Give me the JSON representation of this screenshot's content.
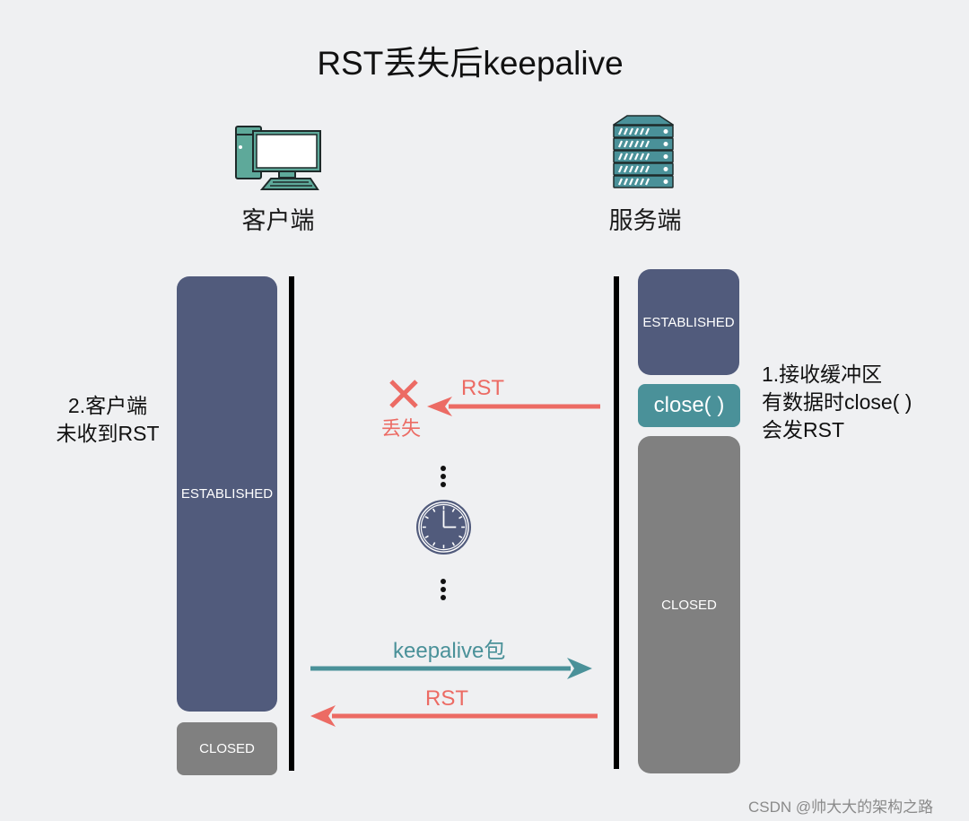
{
  "title": "RST丢失后keepalive",
  "nodes": {
    "client": {
      "label": "客户端",
      "icon": "computer-icon"
    },
    "server": {
      "label": "服务端",
      "icon": "server-rack-icon"
    }
  },
  "client_states": {
    "established": "ESTABLISHED",
    "closed": "CLOSED"
  },
  "server_states": {
    "established": "ESTABLISHED",
    "close_call": "close( )",
    "closed": "CLOSED"
  },
  "notes": {
    "server_note": [
      "1.接收缓冲区",
      "有数据时close( )",
      "会发RST"
    ],
    "client_note": [
      "2.客户端",
      "未收到RST"
    ]
  },
  "messages": {
    "rst_lost": {
      "label": "RST",
      "lost_label": "丢失",
      "direction": "server-to-client",
      "status": "lost"
    },
    "wait": {
      "icon": "clock-icon"
    },
    "keepalive": {
      "label": "keepalive包",
      "direction": "client-to-server"
    },
    "rst_reply": {
      "label": "RST",
      "direction": "server-to-client"
    }
  },
  "colors": {
    "background": "#eff0f2",
    "established": "#515b7c",
    "closed": "#808080",
    "close_call": "#4a9199",
    "rst": "#ec6b64",
    "keepalive": "#4a9199",
    "lifeline": "#000000"
  },
  "watermark": "CSDN @帅大大的架构之路"
}
